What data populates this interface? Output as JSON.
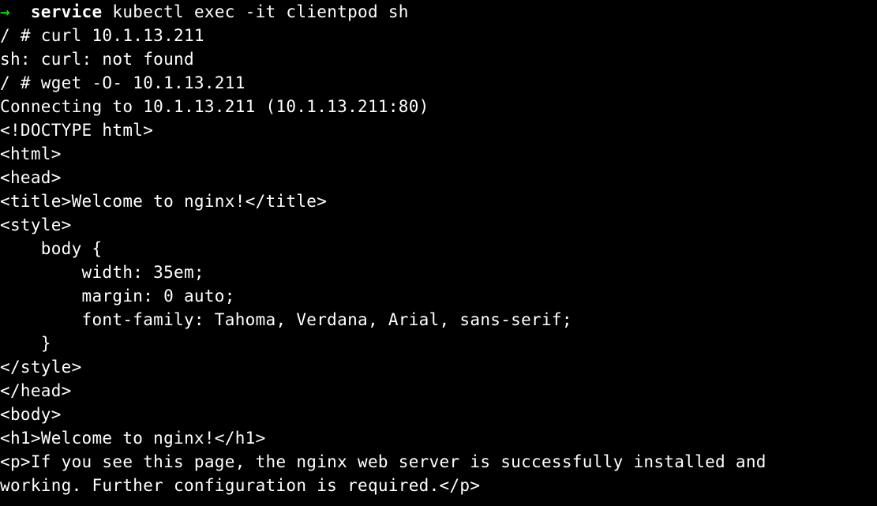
{
  "terminal": {
    "line1_arrow": "→",
    "line1_service": "  service",
    "line1_cmd": " kubectl exec -it clientpod sh",
    "line2": "/ # curl 10.1.13.211",
    "line3": "sh: curl: not found",
    "line4": "/ # wget -O- 10.1.13.211",
    "line5": "Connecting to 10.1.13.211 (10.1.13.211:80)",
    "line6": "<!DOCTYPE html>",
    "line7": "<html>",
    "line8": "<head>",
    "line9": "<title>Welcome to nginx!</title>",
    "line10": "<style>",
    "line11": "    body {",
    "line12": "        width: 35em;",
    "line13": "        margin: 0 auto;",
    "line14": "        font-family: Tahoma, Verdana, Arial, sans-serif;",
    "line15": "    }",
    "line16": "</style>",
    "line17": "</head>",
    "line18": "<body>",
    "line19": "<h1>Welcome to nginx!</h1>",
    "line20": "<p>If you see this page, the nginx web server is successfully installed and",
    "line21": "working. Further configuration is required.</p>"
  }
}
